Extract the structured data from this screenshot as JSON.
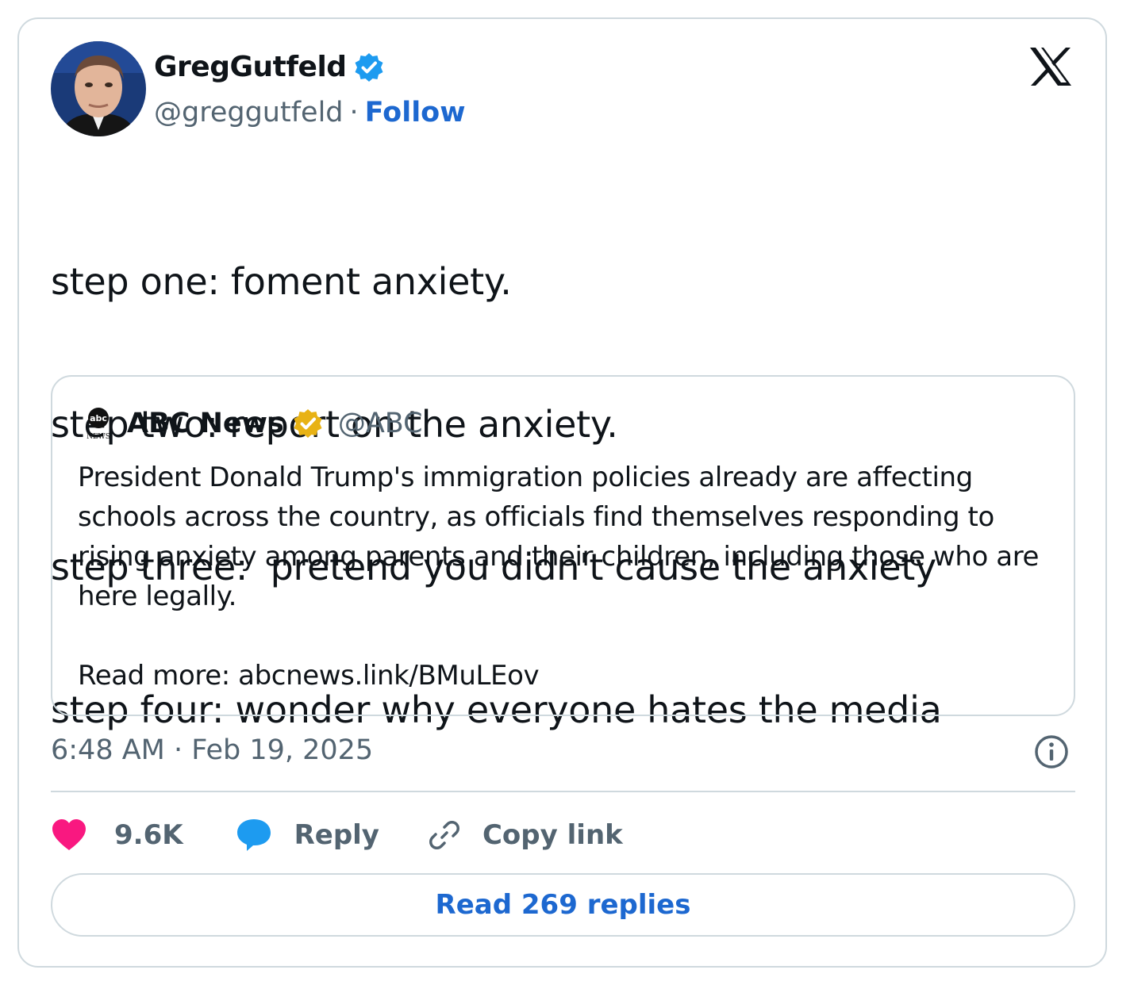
{
  "author": {
    "display_name": "GregGutfeld",
    "handle": "@greggutfeld",
    "separator": "·",
    "follow_label": "Follow",
    "verified_badge": "blue-check-icon"
  },
  "platform_logo": "x-logo-icon",
  "tweet": {
    "lines": [
      "step one: foment anxiety.",
      "step two: report on the anxiety.",
      "step three:  pretend you didn't cause the anxiety",
      "step four: wonder why everyone hates the media"
    ]
  },
  "quoted_tweet": {
    "logo": "abc-news-logo",
    "display_name": "ABC News",
    "handle": "@ABC",
    "verified_badge": "gold-check-icon",
    "text": "President Donald Trump's immigration policies already are affecting schools across the country, as officials find themselves responding to rising anxiety among parents and their children, including those who are here legally.",
    "read_more": "Read more: abcnews.link/BMuLEov"
  },
  "timestamp": "6:48 AM · Feb 19, 2025",
  "actions": {
    "like_count": "9.6K",
    "reply_label": "Reply",
    "copy_link_label": "Copy link"
  },
  "read_replies_label": "Read 269 replies",
  "colors": {
    "accent": "#1d68d0",
    "like": "#f91880",
    "reply": "#1d9bf0",
    "muted": "#536471",
    "border": "#cfd9de"
  }
}
